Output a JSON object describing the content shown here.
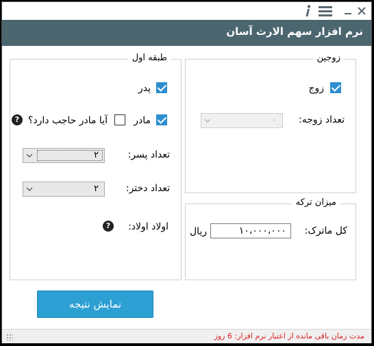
{
  "window": {
    "title": "نرم افزار سهم الارث آسان"
  },
  "topbar": {
    "info_icon": "info-icon",
    "menu_icon": "hamburger-menu-icon",
    "minimize_icon": "minimize-icon",
    "close_icon": "close-icon"
  },
  "spouses": {
    "title": "زوجین",
    "husband_label": "زوج",
    "husband_checked": true,
    "wives_count_label": "تعداد زوجه:",
    "wives_count_value": "۰",
    "wives_count_disabled": true
  },
  "first_class": {
    "title": "طبقه اول",
    "father_label": "پدر",
    "father_checked": true,
    "mother_label": "مادر",
    "mother_checked": true,
    "mother_hajib_label": "آیا مادر حاجب دارد؟",
    "mother_hajib_checked": false,
    "sons_label": "تعداد پسر:",
    "sons_value": "۲",
    "daughters_label": "تعداد دختر:",
    "daughters_value": "۲",
    "grandchildren_label": "اولاد اولاد:"
  },
  "estate": {
    "title": "میزان ترکه",
    "total_label": "کل ماترک:",
    "total_value": "۱۰،۰۰۰،۰۰۰",
    "currency": "ریال"
  },
  "actions": {
    "show_result_label": "نمایش نتیجه"
  },
  "status": {
    "text": "مدت زمان باقی مانده از اعتبار نرم افزار: 6 روز",
    "color": "#e02020"
  },
  "colors": {
    "titlebar": "#4c6670",
    "accent": "#2c9fd3"
  }
}
